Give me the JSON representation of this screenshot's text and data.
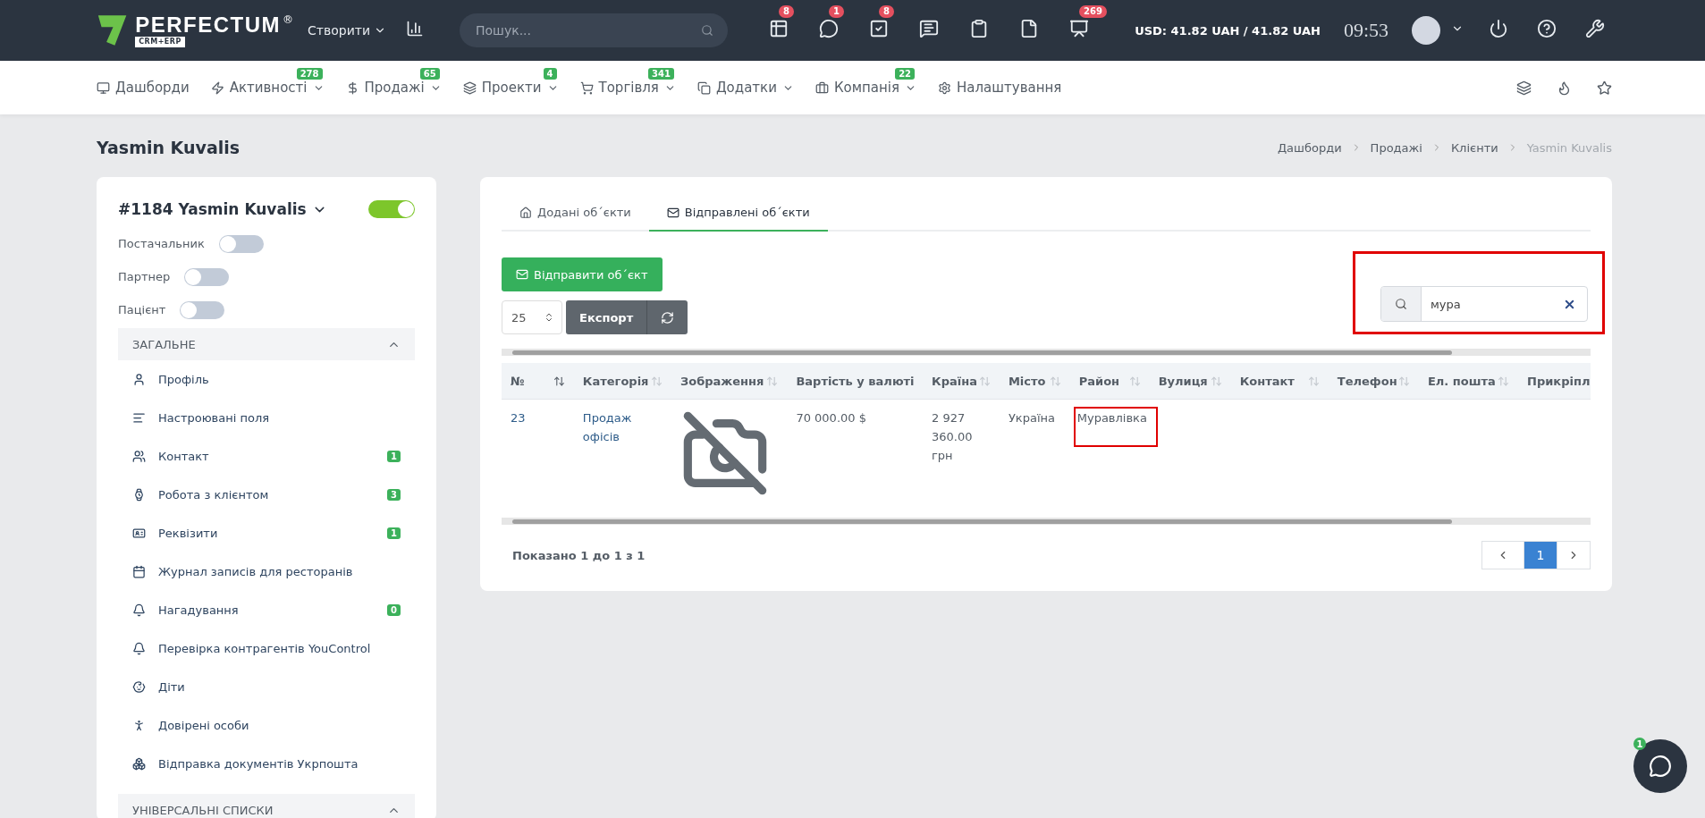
{
  "topbar": {
    "logo": {
      "name": "PERFECTUM",
      "mark": "®",
      "tag": "CRM+ERP"
    },
    "create_menu": "Створити",
    "search": {
      "placeholder": "Пошук..."
    },
    "icons": [
      {
        "kind": "table",
        "badge": "8"
      },
      {
        "kind": "chat",
        "badge": "1"
      },
      {
        "kind": "task",
        "badge": "8"
      },
      {
        "kind": "message"
      },
      {
        "kind": "clipboard"
      },
      {
        "kind": "file"
      },
      {
        "kind": "board",
        "badge": "269"
      }
    ],
    "currency": "USD: 41.82 UAH / 41.82 UAH",
    "time": "09:53"
  },
  "nav": {
    "items": [
      {
        "label": "Дашборди",
        "dropdown": false
      },
      {
        "label": "Активності",
        "badge": "278",
        "dropdown": true
      },
      {
        "label": "Продажі",
        "badge": "65",
        "dropdown": true
      },
      {
        "label": "Проекти",
        "badge": "4",
        "dropdown": true
      },
      {
        "label": "Торгівля",
        "badge": "341",
        "dropdown": true
      },
      {
        "label": "Додатки",
        "dropdown": true
      },
      {
        "label": "Компанія",
        "badge": "22",
        "dropdown": true
      },
      {
        "label": "Налаштування",
        "dropdown": false
      }
    ]
  },
  "page": {
    "title": "Yasmin Kuvalis",
    "breadcrumbs": [
      {
        "label": "Дашборди",
        "current": false
      },
      {
        "label": "Продажі",
        "current": false
      },
      {
        "label": "Клієнти",
        "current": false
      },
      {
        "label": "Yasmin Kuvalis",
        "current": true
      }
    ]
  },
  "client": {
    "title": "#1184 Yasmin Kuvalis",
    "active": true,
    "flags": [
      {
        "label": "Постачальник",
        "on": false
      },
      {
        "label": "Партнер",
        "on": false
      },
      {
        "label": "Пацієнт",
        "on": false
      }
    ],
    "sections": [
      {
        "title": "ЗАГАЛЬНЕ",
        "expanded": true,
        "items": [
          {
            "label": "Профіль"
          },
          {
            "label": "Настроювані поля"
          },
          {
            "label": "Контакт",
            "badge": "1"
          },
          {
            "label": "Робота з клієнтом",
            "badge": "3"
          },
          {
            "label": "Реквізити",
            "badge": "1"
          },
          {
            "label": "Журнал записів для ресторанів"
          },
          {
            "label": "Нагадування",
            "badge": "0"
          },
          {
            "label": "Перевірка контрагентів YouControl"
          },
          {
            "label": "Діти"
          },
          {
            "label": "Довірені особи"
          },
          {
            "label": "Відправка документів Укрпошта"
          }
        ]
      },
      {
        "title": "УНІВЕРСАЛЬНІ СПИСКИ",
        "expanded": true
      }
    ]
  },
  "objects": {
    "tabs": [
      {
        "label": "Додані об΄єкти",
        "selected": false
      },
      {
        "label": "Відправлені об΄єкти",
        "selected": true
      }
    ],
    "send_button": "Відправити об΄єкт",
    "page_size": "25",
    "export_button": "Експорт",
    "search": {
      "value": "мура",
      "highlighted": true
    },
    "table": {
      "columns": [
        "№",
        "Категорія",
        "Зображення",
        "Вартість у валюті",
        "Країна",
        "Місто",
        "Район",
        "Вулиця",
        "Контакт",
        "Телефон",
        "Ел. пошта",
        "Прикріпл"
      ],
      "rows": [
        {
          "cells": [
            {
              "kind": "link",
              "text": "23",
              "highlighted": false
            },
            {
              "kind": "link",
              "text": "Продаж офісів",
              "highlighted": false
            },
            {
              "kind": "no-image",
              "highlighted": false
            },
            {
              "kind": "text",
              "text": "70 000.00 $",
              "highlighted": false
            },
            {
              "kind": "text",
              "text": "2 927 360.00 грн",
              "highlighted": false
            },
            {
              "kind": "text",
              "text": "Україна",
              "highlighted": false
            },
            {
              "kind": "text",
              "text": "Муравлівка",
              "highlighted": true
            }
          ]
        }
      ]
    },
    "footer": "Показано 1 до 1 з 1",
    "pages": [
      {
        "label": "1",
        "selected": true
      }
    ]
  },
  "chat": {
    "badge": "1"
  }
}
